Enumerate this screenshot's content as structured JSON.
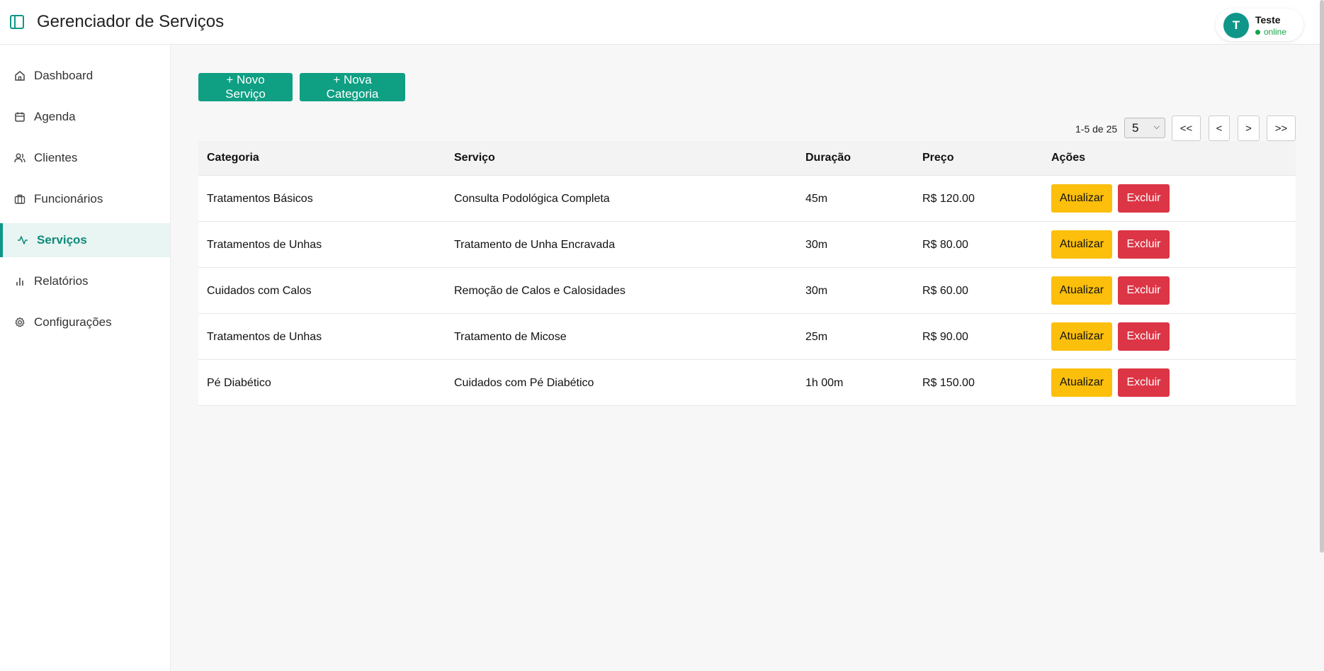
{
  "header": {
    "title": "Gerenciador de Serviços",
    "user": {
      "initial": "T",
      "name": "Teste",
      "status": "online"
    }
  },
  "sidebar": {
    "items": [
      {
        "label": "Dashboard",
        "icon": "home-icon"
      },
      {
        "label": "Agenda",
        "icon": "calendar-icon"
      },
      {
        "label": "Clientes",
        "icon": "users-icon"
      },
      {
        "label": "Funcionários",
        "icon": "briefcase-icon"
      },
      {
        "label": "Serviços",
        "icon": "activity-icon",
        "active": true
      },
      {
        "label": "Relatórios",
        "icon": "bar-chart-icon"
      },
      {
        "label": "Configurações",
        "icon": "gear-icon"
      }
    ]
  },
  "toolbar": {
    "new_service": "+ Novo Serviço",
    "new_category": "+ Nova Categoria"
  },
  "pagination": {
    "info": "1-5 de 25",
    "page_size": "5",
    "first": "<<",
    "prev": "<",
    "next": ">",
    "last": ">>"
  },
  "table": {
    "headers": [
      "Categoria",
      "Serviço",
      "Duração",
      "Preço",
      "Ações"
    ],
    "rows": [
      {
        "categoria": "Tratamentos Básicos",
        "servico": "Consulta Podológica Completa",
        "duracao": "45m",
        "preco": "R$ 120.00"
      },
      {
        "categoria": "Tratamentos de Unhas",
        "servico": "Tratamento de Unha Encravada",
        "duracao": "30m",
        "preco": "R$ 80.00"
      },
      {
        "categoria": "Cuidados com Calos",
        "servico": "Remoção de Calos e Calosidades",
        "duracao": "30m",
        "preco": "R$ 60.00"
      },
      {
        "categoria": "Tratamentos de Unhas",
        "servico": "Tratamento de Micose",
        "duracao": "25m",
        "preco": "R$ 90.00"
      },
      {
        "categoria": "Pé Diabético",
        "servico": "Cuidados com Pé Diabético",
        "duracao": "1h 00m",
        "preco": "R$ 150.00"
      }
    ],
    "update_label": "Atualizar",
    "delete_label": "Excluir"
  },
  "colors": {
    "primary": "#0f9f83",
    "update": "#fbbf0c",
    "delete": "#dc3545",
    "online": "#16a34a"
  }
}
